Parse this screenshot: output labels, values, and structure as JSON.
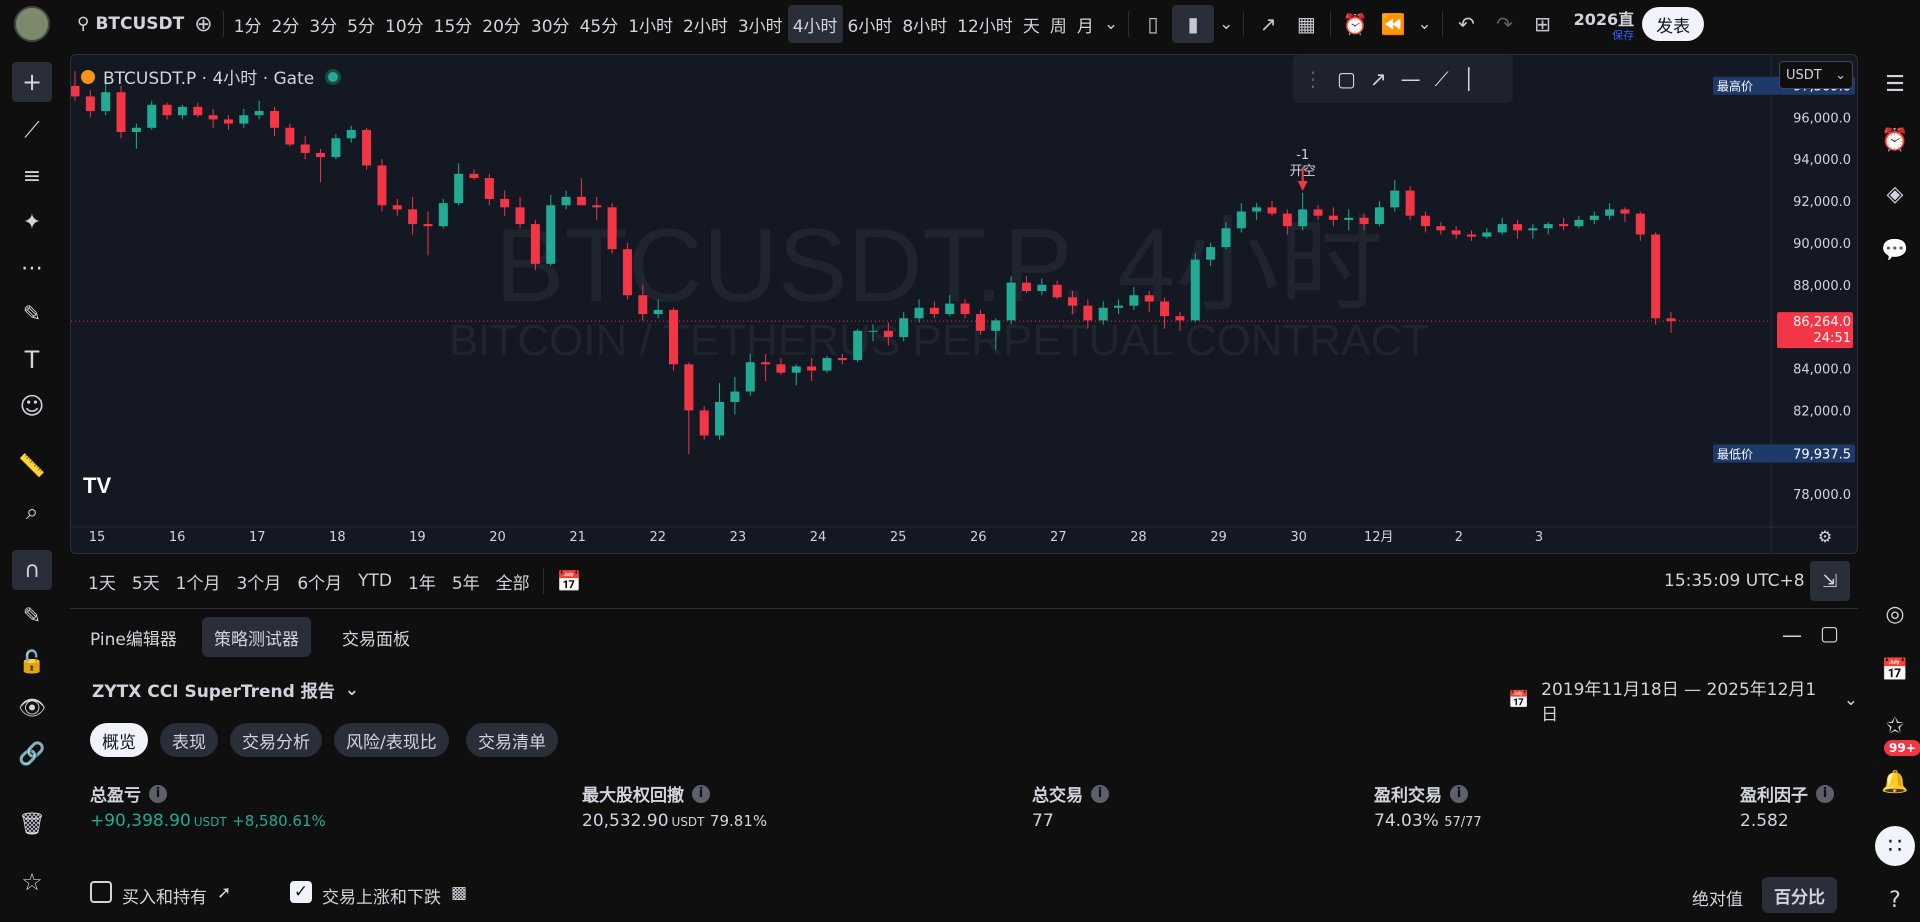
{
  "topbar": {
    "symbol": "BTCUSDT",
    "intervals": [
      "1分",
      "2分",
      "3分",
      "5分",
      "10分",
      "15分",
      "20分",
      "30分",
      "45分",
      "1小时",
      "2小时",
      "3小时",
      "4小时",
      "6小时",
      "8小时",
      "12小时",
      "天",
      "周",
      "月"
    ],
    "active_interval": "4小时",
    "year_label": "2026直",
    "save_label": "保存",
    "publish_label": "发表"
  },
  "chart": {
    "legend_title": "BTCUSDT.P · 4小时 · Gate",
    "watermark_main": "BTCUSDT.P, 4小时",
    "watermark_sub": "BITCOIN / TETHERUS PERPETUAL CONTRACT",
    "currency": "USDT",
    "high_label": "最高价",
    "high_value": "97,509.0",
    "low_label": "最低价",
    "low_value": "79,937.5",
    "last_price": "86,264.0",
    "countdown": "24:51",
    "trade_marker_qty": "-1",
    "trade_marker_label": "开空",
    "logo": "TV",
    "price_ticks": [
      "96,000.0",
      "94,000.0",
      "92,000.0",
      "90,000.0",
      "88,000.0",
      "86,000.0",
      "84,000.0",
      "82,000.0",
      "80,000.0",
      "78,000.0"
    ],
    "time_ticks": [
      "15",
      "16",
      "17",
      "18",
      "19",
      "20",
      "21",
      "22",
      "23",
      "24",
      "25",
      "26",
      "27",
      "28",
      "29",
      "30",
      "12月",
      "2",
      "3"
    ],
    "colors": {
      "up": "#22ab94",
      "down": "#f23645",
      "bg": "#141823"
    }
  },
  "chart_data": {
    "type": "candlestick",
    "title": "BTCUSDT.P · 4小时 · Gate",
    "ylim": [
      77000,
      98500
    ],
    "ohlc": [
      [
        97500,
        98200,
        96800,
        97000
      ],
      [
        97000,
        97300,
        96000,
        96300
      ],
      [
        96300,
        97800,
        96100,
        97200
      ],
      [
        97200,
        97500,
        95000,
        95300
      ],
      [
        95300,
        95700,
        94500,
        95500
      ],
      [
        95500,
        96800,
        95400,
        96600
      ],
      [
        96600,
        96700,
        95900,
        96100
      ],
      [
        96100,
        96600,
        95900,
        96500
      ],
      [
        96500,
        96700,
        96000,
        96100
      ],
      [
        96100,
        96400,
        95500,
        95900
      ],
      [
        95900,
        96100,
        95400,
        95700
      ],
      [
        95700,
        96400,
        95500,
        96100
      ],
      [
        96100,
        96800,
        95900,
        96300
      ],
      [
        96300,
        96500,
        95100,
        95500
      ],
      [
        95500,
        95700,
        94600,
        94700
      ],
      [
        94700,
        95100,
        94000,
        94300
      ],
      [
        94300,
        94500,
        92900,
        94100
      ],
      [
        94100,
        95200,
        94000,
        95000
      ],
      [
        95000,
        95600,
        94800,
        95400
      ],
      [
        95400,
        95500,
        93500,
        93700
      ],
      [
        93700,
        94000,
        91500,
        91800
      ],
      [
        91800,
        92100,
        91300,
        91600
      ],
      [
        91600,
        92200,
        90400,
        90900
      ],
      [
        90900,
        91500,
        89400,
        90800
      ],
      [
        90800,
        92100,
        90700,
        91900
      ],
      [
        91900,
        93800,
        91800,
        93300
      ],
      [
        93300,
        93500,
        93000,
        93100
      ],
      [
        93100,
        93300,
        91800,
        92100
      ],
      [
        92100,
        92500,
        91300,
        91700
      ],
      [
        91700,
        92200,
        90700,
        90900
      ],
      [
        90900,
        91100,
        88700,
        89000
      ],
      [
        89000,
        92300,
        88900,
        91800
      ],
      [
        91800,
        92500,
        91600,
        92200
      ],
      [
        92200,
        93100,
        91800,
        91800
      ],
      [
        91800,
        92200,
        91100,
        91700
      ],
      [
        91700,
        91900,
        89500,
        89700
      ],
      [
        89700,
        90000,
        87300,
        87500
      ],
      [
        87500,
        88000,
        86300,
        86600
      ],
      [
        86600,
        87300,
        86400,
        86800
      ],
      [
        86800,
        86900,
        83900,
        84200
      ],
      [
        84200,
        84300,
        79900,
        82000
      ],
      [
        82000,
        82200,
        80600,
        80800
      ],
      [
        80800,
        83300,
        80600,
        82400
      ],
      [
        82400,
        83600,
        81800,
        82900
      ],
      [
        82900,
        84700,
        82700,
        84300
      ],
      [
        84300,
        84700,
        83400,
        84200
      ],
      [
        84200,
        84500,
        83700,
        83800
      ],
      [
        83800,
        84200,
        83200,
        84100
      ],
      [
        84100,
        84500,
        83400,
        83900
      ],
      [
        83900,
        84600,
        83800,
        84500
      ],
      [
        84500,
        84700,
        84200,
        84400
      ],
      [
        84400,
        85900,
        84300,
        85800
      ],
      [
        85800,
        86100,
        85300,
        85800
      ],
      [
        85800,
        86200,
        85100,
        85500
      ],
      [
        85500,
        86700,
        85300,
        86400
      ],
      [
        86400,
        87300,
        86200,
        86900
      ],
      [
        86900,
        87200,
        86400,
        86600
      ],
      [
        86600,
        87500,
        86500,
        87100
      ],
      [
        87100,
        87300,
        86400,
        86600
      ],
      [
        86600,
        86800,
        85600,
        85800
      ],
      [
        85800,
        86400,
        84900,
        86300
      ],
      [
        86300,
        88400,
        86100,
        88100
      ],
      [
        88100,
        88400,
        87600,
        87700
      ],
      [
        87700,
        88300,
        87500,
        88000
      ],
      [
        88000,
        88200,
        87300,
        87400
      ],
      [
        87400,
        87700,
        86600,
        87000
      ],
      [
        87000,
        87300,
        85900,
        86300
      ],
      [
        86300,
        87200,
        86100,
        86900
      ],
      [
        86900,
        87300,
        86600,
        87000
      ],
      [
        87000,
        87900,
        86800,
        87500
      ],
      [
        87500,
        87700,
        86700,
        87200
      ],
      [
        87200,
        87400,
        85900,
        86500
      ],
      [
        86500,
        86700,
        85800,
        86300
      ],
      [
        86300,
        89500,
        86200,
        89200
      ],
      [
        89200,
        90000,
        88900,
        89800
      ],
      [
        89800,
        91000,
        89700,
        90700
      ],
      [
        90700,
        91900,
        90500,
        91500
      ],
      [
        91500,
        91900,
        91100,
        91700
      ],
      [
        91700,
        92000,
        91300,
        91400
      ],
      [
        91400,
        91600,
        90400,
        90800
      ],
      [
        90800,
        92400,
        90600,
        91600
      ],
      [
        91600,
        91800,
        91100,
        91300
      ],
      [
        91300,
        91700,
        90800,
        91100
      ],
      [
        91100,
        91600,
        90600,
        91200
      ],
      [
        91200,
        91400,
        90600,
        90900
      ],
      [
        90900,
        92000,
        90800,
        91700
      ],
      [
        91700,
        93000,
        91500,
        92500
      ],
      [
        92500,
        92700,
        91100,
        91300
      ],
      [
        91300,
        91500,
        90500,
        90800
      ],
      [
        90800,
        91000,
        90400,
        90600
      ],
      [
        90600,
        90800,
        90200,
        90400
      ],
      [
        90400,
        90600,
        90100,
        90300
      ],
      [
        90300,
        90700,
        90200,
        90500
      ],
      [
        90500,
        91200,
        90400,
        90900
      ],
      [
        90900,
        91100,
        90200,
        90600
      ],
      [
        90600,
        90900,
        90200,
        90700
      ],
      [
        90700,
        91000,
        90400,
        90900
      ],
      [
        90900,
        91200,
        90600,
        90800
      ],
      [
        90800,
        91300,
        90700,
        91100
      ],
      [
        91100,
        91500,
        90900,
        91300
      ],
      [
        91300,
        91900,
        91100,
        91600
      ],
      [
        91600,
        91700,
        91000,
        91400
      ],
      [
        91400,
        91500,
        90100,
        90400
      ],
      [
        90400,
        90500,
        86100,
        86400
      ],
      [
        86400,
        86700,
        85700,
        86264
      ]
    ]
  },
  "time_panel": {
    "ranges": [
      "1天",
      "5天",
      "1个月",
      "3个月",
      "6个月",
      "YTD",
      "1年",
      "5年",
      "全部"
    ],
    "clock": "15:35:09 UTC+8"
  },
  "bottom_panel": {
    "tabs": [
      "Pine编辑器",
      "策略测试器",
      "交易面板"
    ],
    "active_tab": "策略测试器",
    "report_title": "ZYTX CCI SuperTrend 报告",
    "date_range": "2019年11月18日 — 2025年12月1日",
    "subtabs": [
      "概览",
      "表现",
      "交易分析",
      "风险/表现比",
      "交易清单"
    ],
    "metrics": [
      {
        "label": "总盈亏",
        "value": "+90,398.90",
        "unit": "USDT",
        "extra": "+8,580.61%"
      },
      {
        "label": "最大股权回撤",
        "value": "20,532.90",
        "unit": "USDT",
        "extra": "79.81%"
      },
      {
        "label": "总交易",
        "value": "77",
        "unit": "",
        "extra": ""
      },
      {
        "label": "盈利交易",
        "value": "74.03%",
        "unit": "",
        "extra": "57/77"
      },
      {
        "label": "盈利因子",
        "value": "2.582",
        "unit": "",
        "extra": ""
      }
    ],
    "checkbox1": "买入和持有",
    "checkbox2": "交易上涨和下跌",
    "abs_label": "绝对值",
    "pct_label": "百分比"
  },
  "right_toolbar": {
    "badge": "99+"
  }
}
